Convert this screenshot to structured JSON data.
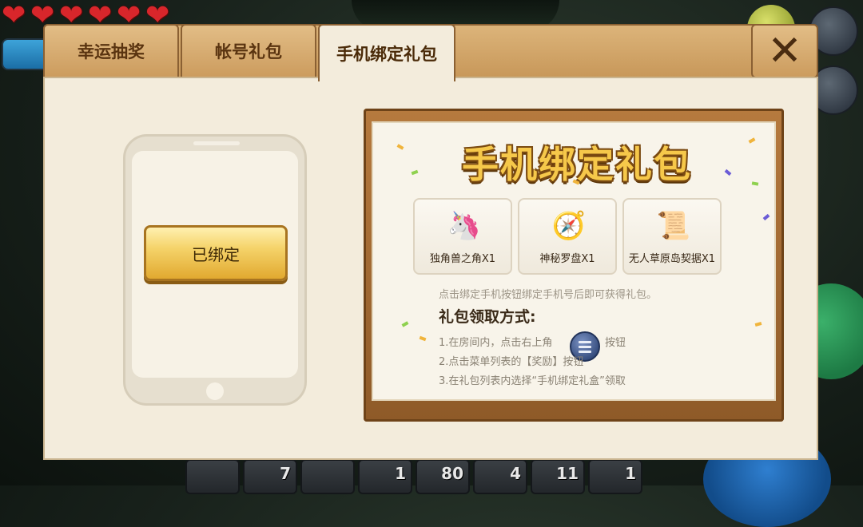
{
  "hud": {
    "hearts": [
      "❤",
      "❤",
      "❤",
      "❤",
      "❤",
      "❤"
    ],
    "hotbar_counts": [
      "",
      "7",
      "",
      "1",
      "80",
      "4",
      "11",
      "1"
    ]
  },
  "tabs": [
    {
      "label": "幸运抽奖",
      "active": false
    },
    {
      "label": "帐号礼包",
      "active": false
    },
    {
      "label": "手机绑定礼包",
      "active": true
    }
  ],
  "close_label": "✕",
  "phone": {
    "status_button": "已绑定"
  },
  "board": {
    "title": "手机绑定礼包",
    "rewards": [
      {
        "name": "独角兽之角X1",
        "icon": "unicorn-horn-icon",
        "glyph": "🦄"
      },
      {
        "name": "神秘罗盘X1",
        "icon": "compass-icon",
        "glyph": "🧭"
      },
      {
        "name": "无人草原岛契据X1",
        "icon": "deed-scroll-icon",
        "glyph": "📜"
      }
    ],
    "hint": "点击绑定手机按钮绑定手机号后即可获得礼包。",
    "method_title": "礼包领取方式:",
    "steps": [
      {
        "prefix": "1.在房间内，点击右上角",
        "suffix": "按钮"
      },
      {
        "text": "2.点击菜单列表的【奖励】按钮"
      },
      {
        "text": "3.在礼包列表内选择“手机绑定礼盒”领取"
      }
    ]
  },
  "colors": {
    "tab_wood": "#d4a86a",
    "panel_bg": "#f3ecdc",
    "title_gold": "#f6c84a",
    "bound_button": "#f5d36a"
  }
}
